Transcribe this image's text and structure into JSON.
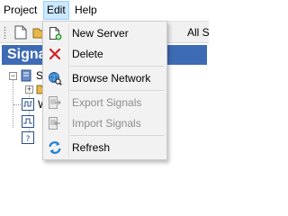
{
  "menubar": {
    "items": [
      {
        "label": "Project"
      },
      {
        "label": "Edit"
      },
      {
        "label": "Help"
      }
    ]
  },
  "toolbar": {
    "combo_label": "All S"
  },
  "panel": {
    "title": "Signa",
    "tree_labels": [
      "S",
      "W"
    ]
  },
  "edit_menu": {
    "items": [
      {
        "label": "New Server",
        "icon": "new-document-icon",
        "enabled": true
      },
      {
        "label": "Delete",
        "icon": "red-x-delete-icon",
        "enabled": true
      },
      {
        "label": "Browse Network",
        "icon": "network-globe-icon",
        "enabled": true
      },
      {
        "label": "Export Signals",
        "icon": "export-icon",
        "enabled": false
      },
      {
        "label": "Import Signals",
        "icon": "import-icon",
        "enabled": false
      },
      {
        "label": "Refresh",
        "icon": "refresh-arrows-icon",
        "enabled": true
      }
    ]
  },
  "colors": {
    "panel_header": "#3e6bb5",
    "menu_highlight": "#cce8ff",
    "delete_red": "#d32027",
    "refresh_blue": "#1f7fd0"
  }
}
